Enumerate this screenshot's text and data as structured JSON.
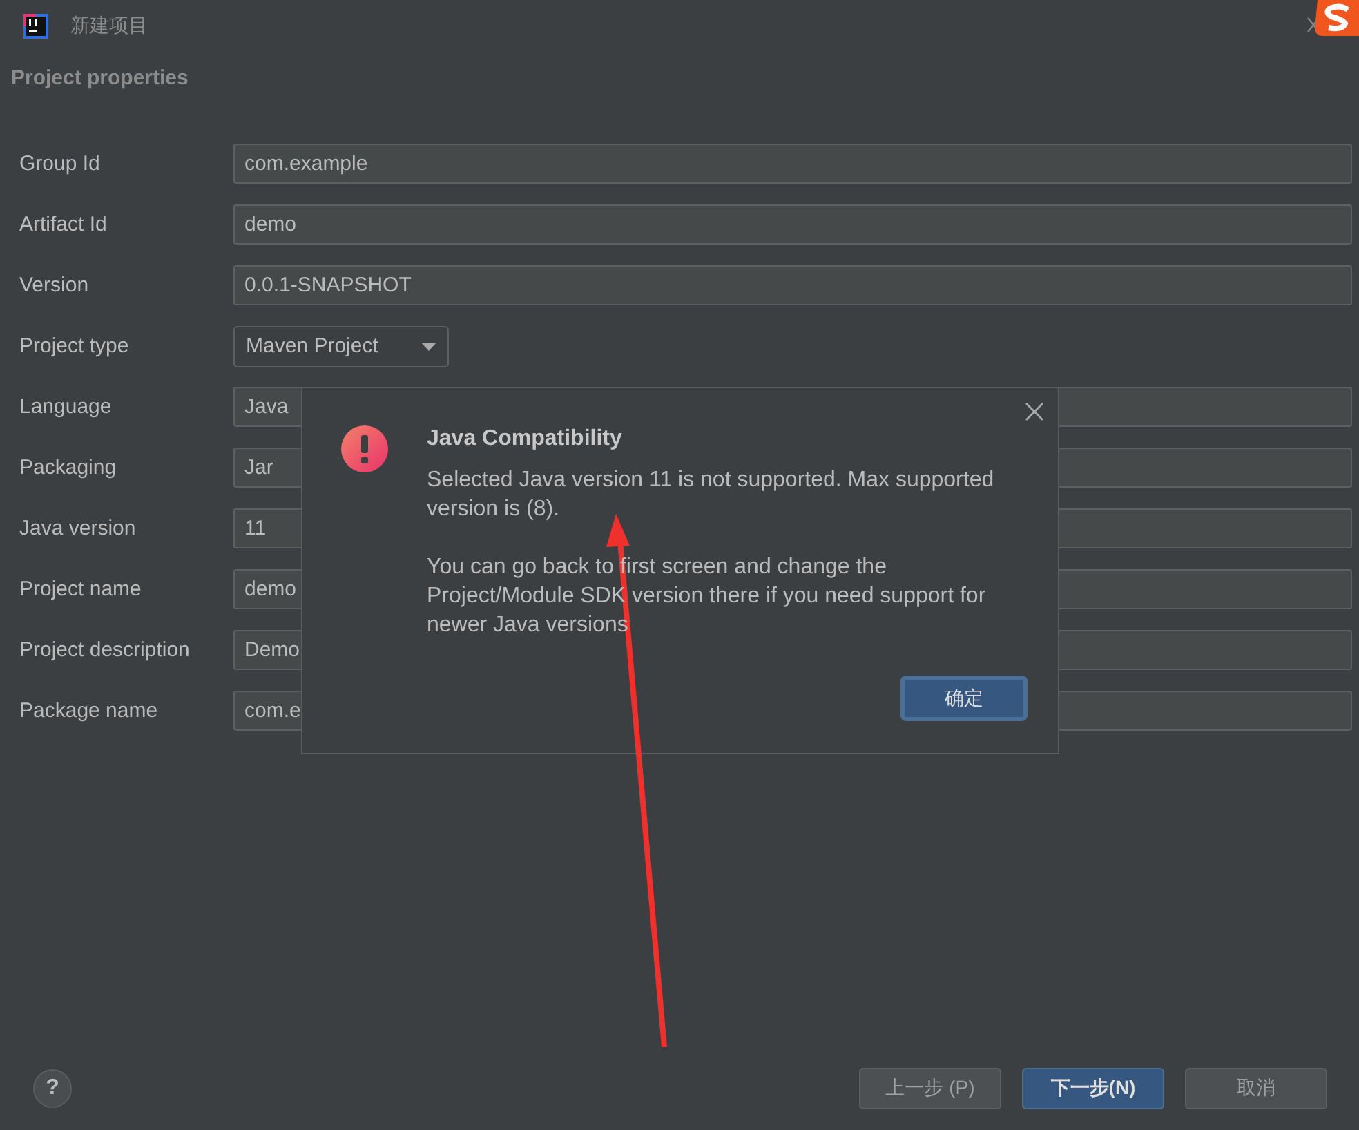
{
  "window": {
    "title": "新建项目"
  },
  "section_title": "Project properties",
  "fields": [
    {
      "label": "Group Id",
      "value": "com.example",
      "kind": "text"
    },
    {
      "label": "Artifact Id",
      "value": "demo",
      "kind": "text"
    },
    {
      "label": "Version",
      "value": "0.0.1-SNAPSHOT",
      "kind": "text"
    },
    {
      "label": "Project type",
      "value": "Maven Project",
      "kind": "dropdown"
    },
    {
      "label": "Language",
      "value": "Java",
      "kind": "text"
    },
    {
      "label": "Packaging",
      "value": "Jar",
      "kind": "text"
    },
    {
      "label": "Java version",
      "value": "11",
      "kind": "text"
    },
    {
      "label": "Project name",
      "value": "demo",
      "kind": "text"
    },
    {
      "label": "Project description",
      "value": "Demo",
      "kind": "text"
    },
    {
      "label": "Package name",
      "value": "com.e",
      "kind": "text"
    }
  ],
  "dialog": {
    "title": "Java Compatibility",
    "message": "Selected Java version 11 is not supported. Max supported version is (8).",
    "hint": "You can go back to first screen and change the Project/Module SDK version there if you need support for newer Java versions",
    "buttons": [
      {
        "label": "确定",
        "primary": true
      }
    ]
  },
  "help": "?",
  "buttons": [
    {
      "label": "上一步 (P)",
      "primary": false
    },
    {
      "label": "下一步(N)",
      "primary": true
    },
    {
      "label": "取消",
      "primary": false
    }
  ]
}
